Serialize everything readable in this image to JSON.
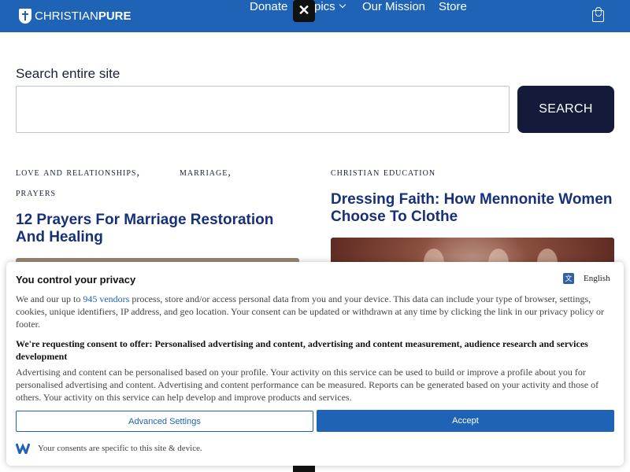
{
  "header": {
    "brand_light": "CHRISTIAN",
    "brand_bold": "PURE",
    "nav": {
      "donate": "Donate",
      "topics": "pics",
      "mission": "Our Mission",
      "store": "Store"
    },
    "close_glyph": "✕",
    "cart_icon": "bag-icon"
  },
  "search": {
    "label": "Search entire site",
    "value": "",
    "button": "SEARCH"
  },
  "cards": [
    {
      "categories": [
        "love and relationships",
        "marriage",
        "prayers"
      ],
      "title": "12 Prayers For Marriage Restoration And Healing"
    },
    {
      "categories": [
        "christian education"
      ],
      "title": "Dressing Faith: How Mennonite Women Choose To Clothe"
    }
  ],
  "consent": {
    "title": "You control your privacy",
    "language": "English",
    "intro_before": "We and our up to ",
    "vendors_link": "945 vendors",
    "intro_after": " process, store and/or access personal data from you and your device. This data can include your type of browser, settings, cookies, unique identifiers, IP address, and geo location. Your consent can be updated or withdrawn at any time by clicking the link in our privacy policy or footer.",
    "purposes": "We're requesting consent to offer: Personalised advertising and content, advertising and content measurement, audience research and services development",
    "details": "Advertising and content can be personalised based on your profile. Your activity on this service can be used to build or improve a profile about you for personalised advertising and content. Advertising and content performance can be measured. Reports can be generated based on your activity and those of others. Your activity on this service can help develop and improve products and services.",
    "advanced_button": "Advanced Settings",
    "accept_button": "Accept",
    "footer": "Your consents are specific to this site & device."
  },
  "colors": {
    "header_bg": "#1e63b5",
    "search_button_bg": "#141b3a",
    "title_color": "#17307a",
    "accept_bg": "#1e63b5"
  }
}
